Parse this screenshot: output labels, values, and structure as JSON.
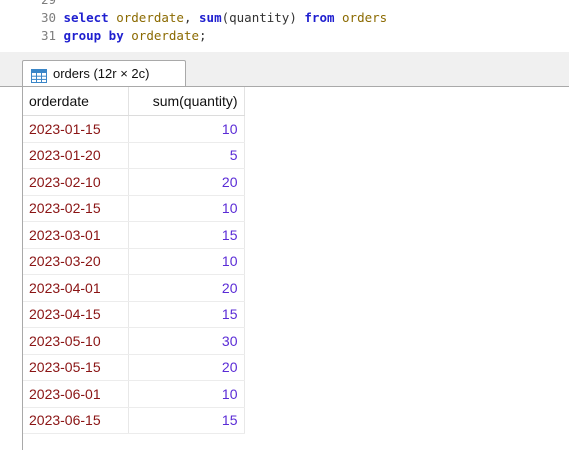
{
  "editor": {
    "lines": [
      {
        "no": "29",
        "tokens": []
      },
      {
        "no": "30",
        "tokens": [
          {
            "t": "select",
            "c": "kw"
          },
          {
            "t": " ",
            "c": "punct"
          },
          {
            "t": "orderdate",
            "c": "ident"
          },
          {
            "t": ", ",
            "c": "punct"
          },
          {
            "t": "sum",
            "c": "kw"
          },
          {
            "t": "(quantity) ",
            "c": "punct"
          },
          {
            "t": "from",
            "c": "kw"
          },
          {
            "t": " ",
            "c": "punct"
          },
          {
            "t": "orders",
            "c": "ident"
          }
        ]
      },
      {
        "no": "31",
        "tokens": [
          {
            "t": "group by",
            "c": "kw"
          },
          {
            "t": " ",
            "c": "punct"
          },
          {
            "t": "orderdate",
            "c": "ident"
          },
          {
            "t": ";",
            "c": "punct"
          }
        ]
      }
    ]
  },
  "result": {
    "tab_label": "orders (12r × 2c)",
    "tab_icon": "table-icon",
    "columns": [
      "orderdate",
      "sum(quantity)"
    ],
    "rows": [
      [
        "2023-01-15",
        "10"
      ],
      [
        "2023-01-20",
        "5"
      ],
      [
        "2023-02-10",
        "20"
      ],
      [
        "2023-02-15",
        "10"
      ],
      [
        "2023-03-01",
        "15"
      ],
      [
        "2023-03-20",
        "10"
      ],
      [
        "2023-04-01",
        "20"
      ],
      [
        "2023-04-15",
        "15"
      ],
      [
        "2023-05-10",
        "30"
      ],
      [
        "2023-05-15",
        "20"
      ],
      [
        "2023-06-01",
        "10"
      ],
      [
        "2023-06-15",
        "15"
      ]
    ]
  },
  "colors": {
    "keyword": "#1f1fcf",
    "identifier": "#8b6a00",
    "date_value": "#8a1414",
    "number_value": "#5a2bd6"
  }
}
